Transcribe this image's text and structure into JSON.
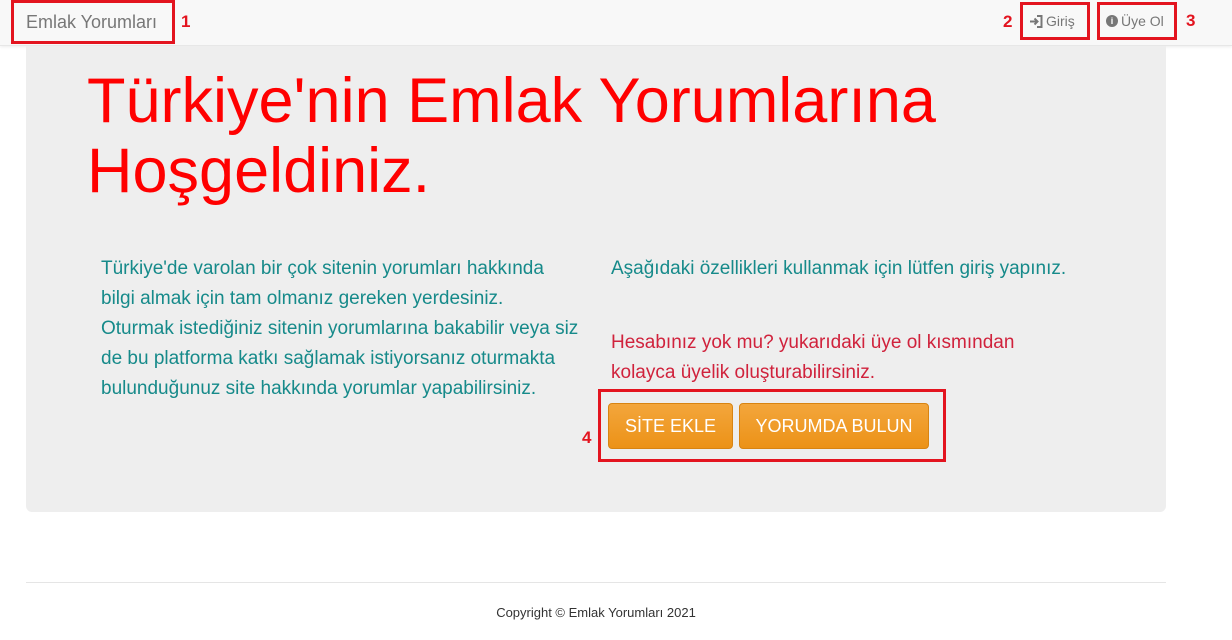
{
  "navbar": {
    "brand": "Emlak Yorumları",
    "login_label": "Giriş",
    "signup_label": "Üye Ol",
    "login_icon": "sign-in-icon",
    "signup_icon": "info-circle-icon"
  },
  "hero": {
    "headline": "Türkiye'nin Emlak Yorumlarına Hoşgeldiniz.",
    "intro": "Türkiye'de varolan bir çok sitenin yorumları hakkında bilgi almak için tam olmanız gereken yerdesiniz. Oturmak istediğiniz sitenin yorumlarına bakabilir veya siz de bu platforma katkı sağlamak istiyorsanız oturmakta bulunduğunuz site hakkında yorumlar yapabilirsiniz.",
    "login_info": "Aşağıdaki özellikleri kullanmak için lütfen giriş yapınız.",
    "signup_hint": "Hesabınız yok mu? yukarıdaki üye ol kısmından kolayca üyelik oluşturabilirsiniz.",
    "add_site_button": "SİTE EKLE",
    "find_review_button": "YORUMDA BULUN"
  },
  "footer": {
    "copyright": "Copyright © Emlak Yorumları 2021"
  },
  "annotations": [
    "1",
    "2",
    "3",
    "4"
  ],
  "colors": {
    "headline": "#ff0000",
    "teal_text": "#168a8a",
    "warning_text": "#d0223c",
    "button_orange": "#ec9217",
    "annotation_red": "#e3141f"
  }
}
